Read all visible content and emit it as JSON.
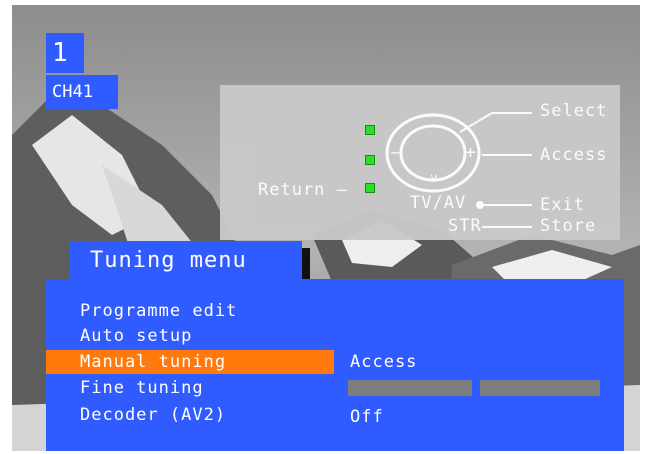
{
  "channel": {
    "number": "1",
    "name": "CH41"
  },
  "help": {
    "select": "Select",
    "access": "Access",
    "return": "Return –",
    "tvav": "TV/AV",
    "exit": "Exit",
    "str": "STR",
    "store": "Store",
    "led_color": "#27e21f"
  },
  "menu": {
    "title": "Tuning menu",
    "items": [
      {
        "label": "Programme edit"
      },
      {
        "label": "Auto setup"
      },
      {
        "label": "Manual tuning",
        "selected": true,
        "value": "Access"
      },
      {
        "label": "Fine tuning",
        "level": 0
      },
      {
        "label": "Decoder (AV2)",
        "value": "Off"
      }
    ]
  },
  "colors": {
    "osd_blue": "#2f5bff",
    "highlight": "#ff7a0a",
    "bar_grey": "#7d7d7d"
  }
}
